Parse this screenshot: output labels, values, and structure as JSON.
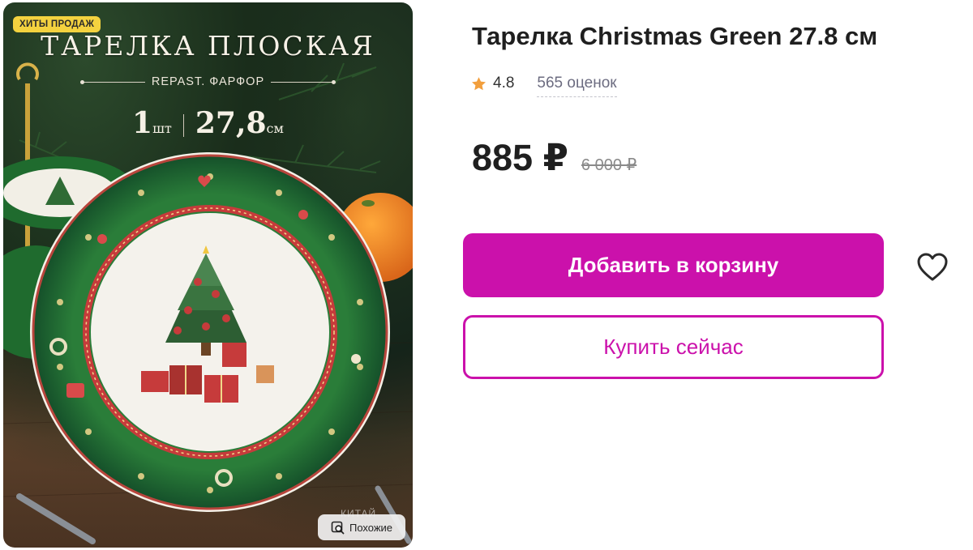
{
  "image": {
    "badge": "ХИТЫ ПРОДАЖ",
    "headline": "ТАРЕЛКА ПЛОСКАЯ",
    "subline": "REPAST. ФАРФОР",
    "qty_num": "1",
    "qty_unit": "шт",
    "size_num": "27,8",
    "size_unit": "см",
    "ghost_text": "КИТАЙ",
    "similar_label": "Похожие"
  },
  "product": {
    "title": "Тарелка Christmas Green 27.8 см",
    "rating": "4.8",
    "reviews": "565 оценок",
    "price": "885 ₽",
    "old_price": "6 000 ₽"
  },
  "actions": {
    "add_to_cart": "Добавить в корзину",
    "buy_now": "Купить сейчас"
  },
  "icons": [
    "star-icon",
    "heart-icon",
    "similar-search-icon"
  ],
  "colors": {
    "accent": "#cb11ab",
    "star": "#f29f3d",
    "badge": "#f4d23f",
    "plate_rim": "#1f6b2e"
  }
}
